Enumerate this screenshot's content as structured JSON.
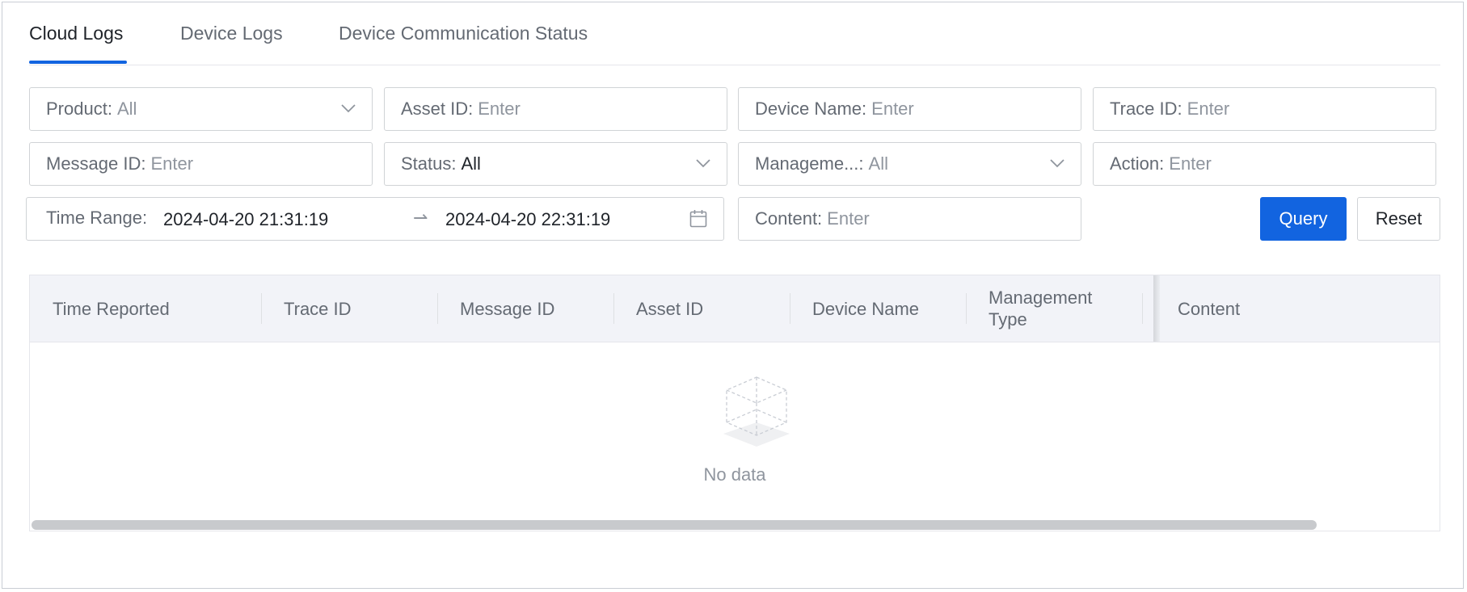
{
  "tabs": [
    {
      "label": "Cloud Logs",
      "active": true
    },
    {
      "label": "Device Logs",
      "active": false
    },
    {
      "label": "Device Communication Status",
      "active": false
    }
  ],
  "filters": {
    "product": {
      "label": "Product:",
      "value": "All"
    },
    "asset_id": {
      "label": "Asset ID:",
      "placeholder": "Enter"
    },
    "device_name": {
      "label": "Device Name:",
      "placeholder": "Enter"
    },
    "trace_id": {
      "label": "Trace ID:",
      "placeholder": "Enter"
    },
    "message_id": {
      "label": "Message ID:",
      "placeholder": "Enter"
    },
    "status": {
      "label": "Status:",
      "value": "All"
    },
    "management_type": {
      "label": "Manageme...:",
      "value": "All"
    },
    "action": {
      "label": "Action:",
      "placeholder": "Enter"
    },
    "time_range": {
      "label": "Time Range:",
      "start": "2024-04-20 21:31:19",
      "end": "2024-04-20 22:31:19"
    },
    "content": {
      "label": "Content:",
      "placeholder": "Enter"
    }
  },
  "buttons": {
    "query": "Query",
    "reset": "Reset"
  },
  "table": {
    "columns": [
      "Time Reported",
      "Trace ID",
      "Message ID",
      "Asset ID",
      "Device Name",
      "Management Type",
      "Content"
    ],
    "empty_text": "No data"
  },
  "colors": {
    "accent": "#1264e0",
    "header_bg": "#f2f3f8",
    "border": "#d0d3d6"
  },
  "icons": {
    "dropdown": "chevron-down-icon",
    "calendar": "calendar-icon",
    "range_arrow": "arrow-right-icon",
    "empty": "empty-box-icon"
  }
}
